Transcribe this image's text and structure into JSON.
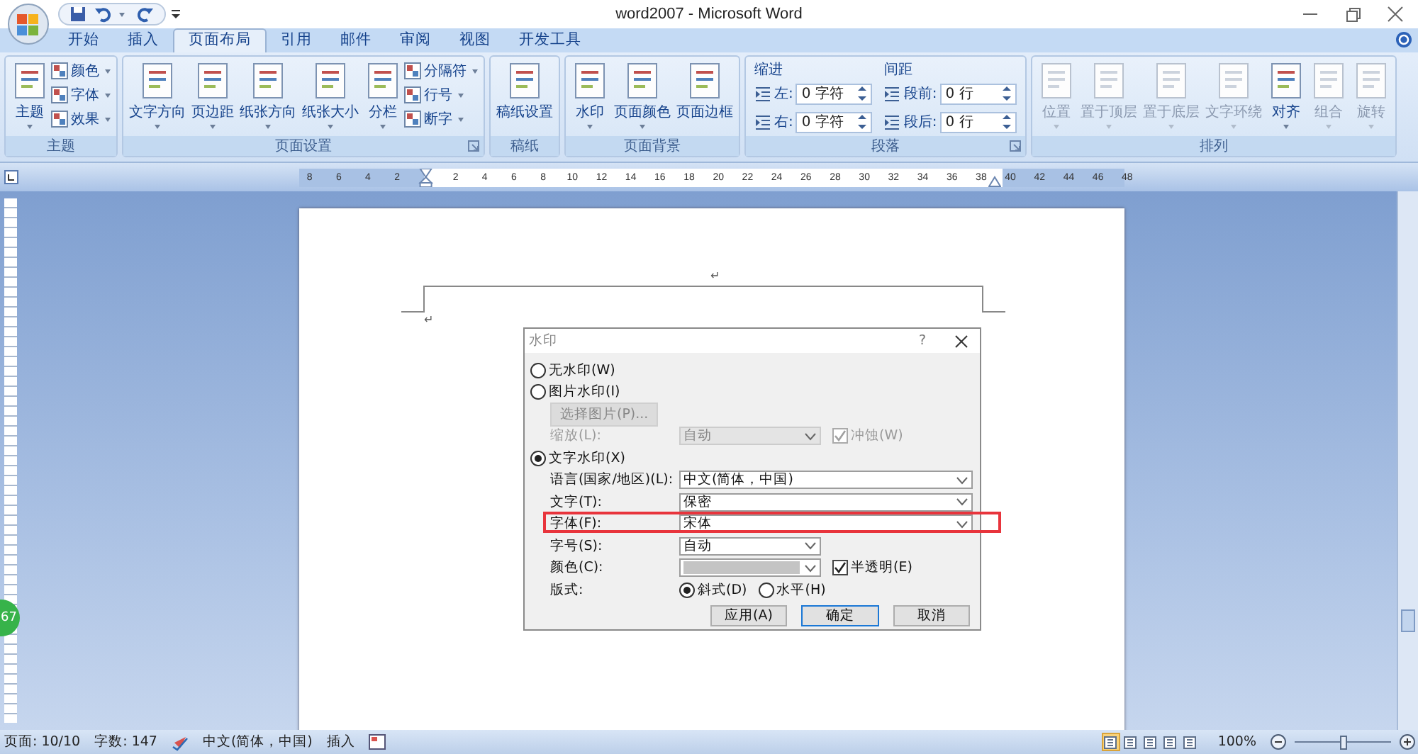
{
  "window": {
    "title": "word2007 - Microsoft Word"
  },
  "tabs": [
    {
      "label": "开始",
      "selected": false
    },
    {
      "label": "插入",
      "selected": false
    },
    {
      "label": "页面布局",
      "selected": true
    },
    {
      "label": "引用",
      "selected": false
    },
    {
      "label": "邮件",
      "selected": false
    },
    {
      "label": "审阅",
      "selected": false
    },
    {
      "label": "视图",
      "selected": false
    },
    {
      "label": "开发工具",
      "selected": false
    }
  ],
  "ribbon_groups": [
    {
      "label": "主题",
      "launcher": false,
      "items": [
        {
          "kind": "large",
          "label": "主题",
          "dropdown": true,
          "disabled": false
        },
        {
          "kind": "stack",
          "buttons": [
            {
              "label": "颜色",
              "dropdown": true
            },
            {
              "label": "字体",
              "dropdown": true
            },
            {
              "label": "效果",
              "dropdown": true
            }
          ]
        }
      ]
    },
    {
      "label": "页面设置",
      "launcher": true,
      "items": [
        {
          "kind": "large",
          "label": "文字方向",
          "dropdown": true,
          "disabled": false
        },
        {
          "kind": "large",
          "label": "页边距",
          "dropdown": true,
          "disabled": false
        },
        {
          "kind": "large",
          "label": "纸张方向",
          "dropdown": true,
          "disabled": false
        },
        {
          "kind": "large",
          "label": "纸张大小",
          "dropdown": true,
          "disabled": false
        },
        {
          "kind": "large",
          "label": "分栏",
          "dropdown": true,
          "disabled": false
        },
        {
          "kind": "stack",
          "buttons": [
            {
              "label": "分隔符",
              "dropdown": true
            },
            {
              "label": "行号",
              "dropdown": true
            },
            {
              "label": "断字",
              "dropdown": true
            }
          ]
        }
      ]
    },
    {
      "label": "稿纸",
      "launcher": false,
      "items": [
        {
          "kind": "large",
          "label": "稿纸设置",
          "dropdown": false,
          "disabled": false
        }
      ]
    },
    {
      "label": "页面背景",
      "launcher": false,
      "items": [
        {
          "kind": "large",
          "label": "水印",
          "dropdown": true,
          "disabled": false
        },
        {
          "kind": "large",
          "label": "页面颜色",
          "dropdown": true,
          "disabled": false
        },
        {
          "kind": "large",
          "label": "页面边框",
          "dropdown": false,
          "disabled": false
        }
      ]
    },
    {
      "label": "段落",
      "launcher": true,
      "items": [
        {
          "kind": "spins",
          "heading": "缩进",
          "fields": [
            {
              "label": "左:",
              "value": "0 字符"
            },
            {
              "label": "右:",
              "value": "0 字符"
            }
          ]
        },
        {
          "kind": "spins",
          "heading": "间距",
          "fields": [
            {
              "label": "段前:",
              "value": "0 行"
            },
            {
              "label": "段后:",
              "value": "0 行"
            }
          ]
        }
      ]
    },
    {
      "label": "排列",
      "launcher": false,
      "items": [
        {
          "kind": "large",
          "label": "位置",
          "dropdown": true,
          "disabled": true
        },
        {
          "kind": "large",
          "label": "置于顶层",
          "dropdown": true,
          "disabled": true
        },
        {
          "kind": "large",
          "label": "置于底层",
          "dropdown": true,
          "disabled": true
        },
        {
          "kind": "large",
          "label": "文字环绕",
          "dropdown": true,
          "disabled": true
        },
        {
          "kind": "large",
          "label": "对齐",
          "dropdown": true,
          "disabled": false
        },
        {
          "kind": "large",
          "label": "组合",
          "dropdown": true,
          "disabled": true
        },
        {
          "kind": "large",
          "label": "旋转",
          "dropdown": true,
          "disabled": true
        }
      ]
    }
  ],
  "ruler": {
    "left_numbers": [
      "8",
      "6",
      "4",
      "2"
    ],
    "numbers": [
      "2",
      "4",
      "6",
      "8",
      "10",
      "12",
      "14",
      "16",
      "18",
      "20",
      "22",
      "24",
      "26",
      "28",
      "30",
      "32",
      "34",
      "36",
      "38",
      "40",
      "42",
      "44",
      "46",
      "48"
    ]
  },
  "document": {
    "marks": [
      "↵",
      "↵"
    ]
  },
  "floating_ball": {
    "label": "67"
  },
  "dialog": {
    "title": "水印",
    "help": "?",
    "rows": [
      {
        "kind": "radio",
        "label": "无水印(W)",
        "selected": false
      },
      {
        "kind": "radio",
        "label": "图片水印(I)",
        "selected": false
      },
      {
        "kind": "button",
        "label": "选择图片(P)...",
        "disabled": true
      },
      {
        "kind": "field",
        "label": "缩放(L):",
        "value": "自动",
        "disabled": true,
        "check": {
          "label": "冲蚀(W)",
          "checked": true,
          "disabled": true
        }
      },
      {
        "kind": "radio",
        "label": "文字水印(X)",
        "selected": true
      },
      {
        "kind": "widecombo",
        "label": "语言(国家/地区)(L):",
        "value": "中文(简体，中国)",
        "highlighted": false
      },
      {
        "kind": "widecombo",
        "label": "文字(T):",
        "value": "保密",
        "highlighted": false
      },
      {
        "kind": "widecombo",
        "label": "字体(F):",
        "value": "宋体",
        "highlighted": true
      },
      {
        "kind": "field",
        "label": "字号(S):",
        "value": "自动",
        "disabled": false
      },
      {
        "kind": "color",
        "label": "颜色(C):",
        "check": {
          "label": "半透明(E)",
          "checked": true,
          "disabled": false
        }
      },
      {
        "kind": "options",
        "label": "版式:",
        "options": [
          {
            "label": "斜式(D)",
            "selected": true
          },
          {
            "label": "水平(H)",
            "selected": false
          }
        ]
      }
    ],
    "buttons": [
      {
        "label": "应用(A)",
        "default": false
      },
      {
        "label": "确定",
        "default": true
      },
      {
        "label": "取消",
        "default": false
      }
    ]
  },
  "status_bar": {
    "page": "页面: 10/10",
    "words": "字数: 147",
    "language": "中文(简体，中国)",
    "mode": "插入",
    "views": [
      {
        "selected": true
      },
      {
        "selected": false
      },
      {
        "selected": false
      },
      {
        "selected": false
      },
      {
        "selected": false
      }
    ],
    "zoom": "100%",
    "zoom_slider": {
      "level": 0.5
    }
  }
}
